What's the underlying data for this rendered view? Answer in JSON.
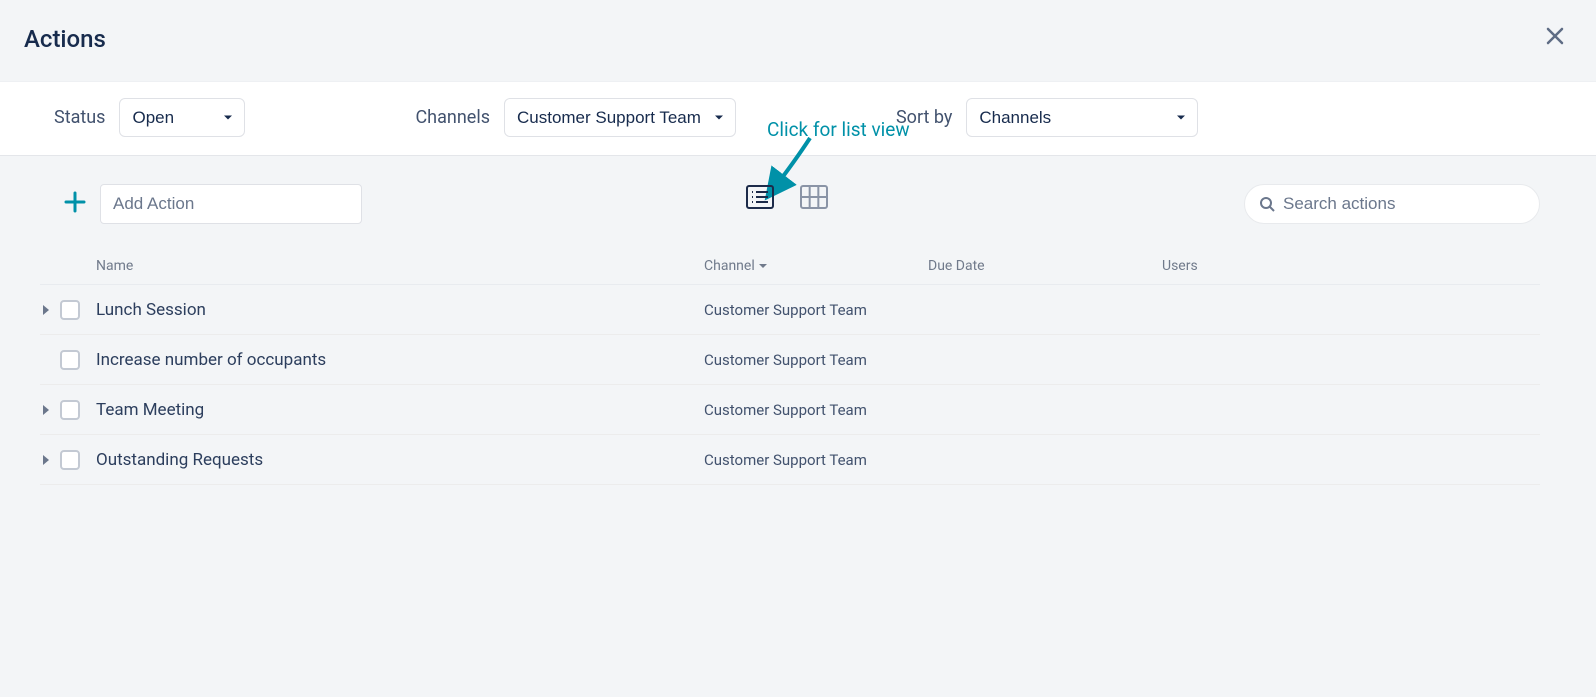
{
  "header": {
    "title": "Actions"
  },
  "filters": {
    "status_label": "Status",
    "status_value": "Open",
    "channels_label": "Channels",
    "channels_value": "Customer Support Team",
    "sort_label": "Sort by",
    "sort_value": "Channels"
  },
  "hint": "Click for list view",
  "toolbar": {
    "add_placeholder": "Add Action",
    "search_placeholder": "Search actions"
  },
  "columns": {
    "name": "Name",
    "channel": "Channel",
    "due": "Due Date",
    "users": "Users"
  },
  "rows": [
    {
      "expandable": true,
      "name": "Lunch Session",
      "channel": "Customer Support Team",
      "due": "",
      "users": ""
    },
    {
      "expandable": false,
      "name": "Increase number of occupants",
      "channel": "Customer Support Team",
      "due": "",
      "users": ""
    },
    {
      "expandable": true,
      "name": "Team Meeting",
      "channel": "Customer Support Team",
      "due": "",
      "users": ""
    },
    {
      "expandable": true,
      "name": "Outstanding Requests",
      "channel": "Customer Support Team",
      "due": "",
      "users": ""
    }
  ]
}
